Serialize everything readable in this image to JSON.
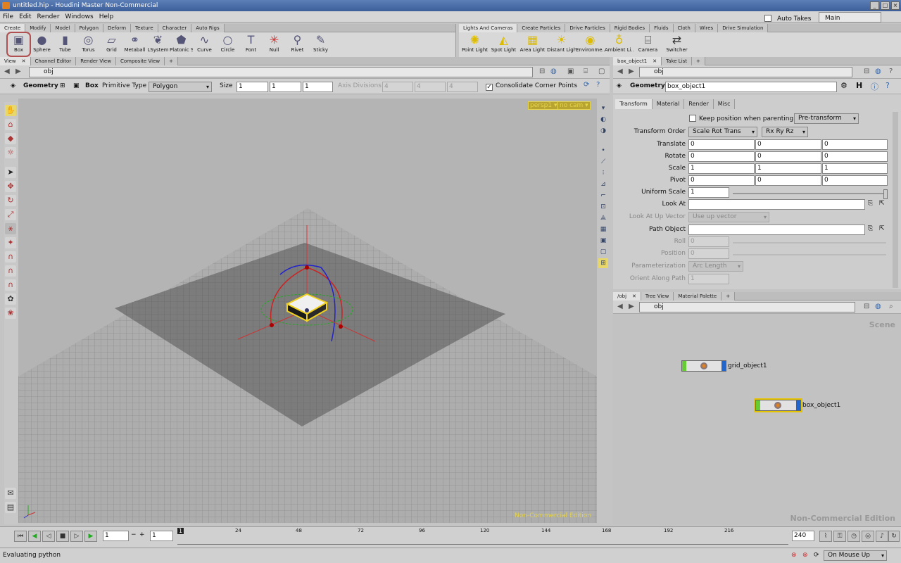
{
  "window": {
    "title": "untitled.hip - Houdini Master Non-Commercial"
  },
  "menu": {
    "items": [
      "File",
      "Edit",
      "Render",
      "Windows",
      "Help"
    ],
    "auto_takes": "Auto Takes",
    "take_select": "Main"
  },
  "shelf_left": {
    "tabs": [
      "Create",
      "Modify",
      "Model",
      "Polygon",
      "Deform",
      "Texture",
      "Character",
      "Auto Rigs"
    ],
    "tools": [
      "Box",
      "Sphere",
      "Tube",
      "Torus",
      "Grid",
      "Metaball",
      "LSystem",
      "Platonic So...",
      "Curve",
      "Circle",
      "Font",
      "Null",
      "Rivet",
      "Sticky"
    ]
  },
  "shelf_right": {
    "tabs": [
      "Lights And Cameras",
      "Create Particles",
      "Drive Particles",
      "Rigid Bodies",
      "Fluids",
      "Cloth",
      "Wires",
      "Drive Simulation"
    ],
    "tools": [
      "Point Light",
      "Spot Light",
      "Area Light",
      "Distant Light",
      "Environme...",
      "Ambient Li...",
      "Camera",
      "Switcher"
    ]
  },
  "viewer": {
    "tabs": [
      "View",
      "Channel Editor",
      "Render View",
      "Composite View"
    ],
    "path": "obj",
    "op_type": "Geometry",
    "op_name": "Box",
    "prim_label": "Primitive Type",
    "prim_value": "Polygon",
    "size_label": "Size",
    "size": [
      "1",
      "1",
      "1"
    ],
    "axis_label": "Axis Divisions",
    "axis": [
      "4",
      "4",
      "4"
    ],
    "consolidate": "Consolidate Corner Points",
    "cam1": "persp1 ▾",
    "cam2": "no cam ▾",
    "watermark": "Non-Commercial Edition"
  },
  "params": {
    "tabs": [
      "box_object1",
      "Take List"
    ],
    "path": "obj",
    "op_type": "Geometry",
    "node_name": "box_object1",
    "subtabs": [
      "Transform",
      "Material",
      "Render",
      "Misc"
    ],
    "keep_pos": "Keep position when parenting",
    "pre_transform": "Pre-transform",
    "transform_order_label": "Transform Order",
    "transform_order": "Scale Rot Trans",
    "rot_order": "Rx Ry Rz",
    "translate_label": "Translate",
    "translate": [
      "0",
      "0",
      "0"
    ],
    "rotate_label": "Rotate",
    "rotate": [
      "0",
      "0",
      "0"
    ],
    "scale_label": "Scale",
    "scale": [
      "1",
      "1",
      "1"
    ],
    "pivot_label": "Pivot",
    "pivot": [
      "0",
      "0",
      "0"
    ],
    "uniform_label": "Uniform Scale",
    "uniform": "1",
    "lookat_label": "Look At",
    "lookat": "",
    "upvec_label": "Look At Up Vector",
    "upvec": "Use up vector",
    "pathobj_label": "Path Object",
    "pathobj": "",
    "roll_label": "Roll",
    "roll": "0",
    "position_label": "Position",
    "position": "0",
    "param_label": "Parameterization",
    "param_value": "Arc Length",
    "orient_label": "Orient Along Path",
    "orient": "1"
  },
  "network": {
    "tabs": [
      "/obj",
      "Tree View",
      "Material Palette"
    ],
    "path": "obj",
    "context": "Scene",
    "nodes": [
      "grid_object1",
      "box_object1"
    ],
    "watermark": "Non-Commercial Edition"
  },
  "timeline": {
    "frame": "1",
    "start": "1",
    "marks": [
      "1",
      "24",
      "48",
      "72",
      "96",
      "120",
      "144",
      "168",
      "192",
      "216"
    ],
    "end": "240",
    "mode": "On Mouse Up"
  },
  "status": {
    "text": "Evaluating python"
  }
}
